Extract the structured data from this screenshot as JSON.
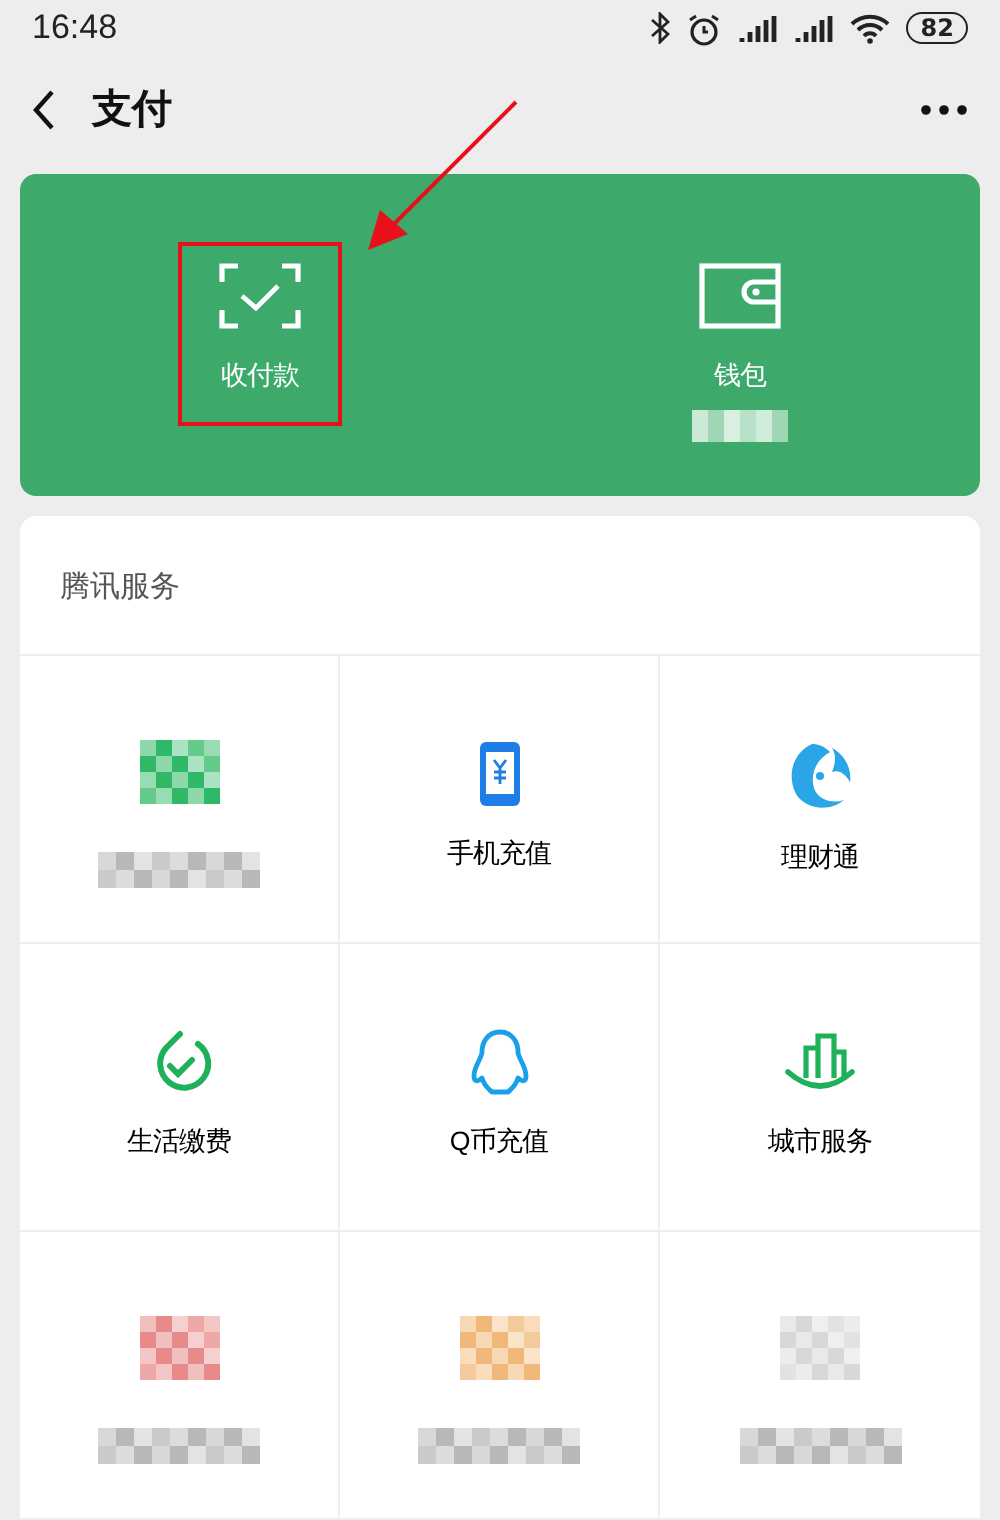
{
  "status_bar": {
    "time": "16:48",
    "battery": "82"
  },
  "header": {
    "title": "支付"
  },
  "actions": [
    {
      "kind": "scan",
      "label": "收付款",
      "highlighted": true,
      "masked_caption": false
    },
    {
      "kind": "wallet",
      "label": "钱包",
      "highlighted": false,
      "masked_caption": true
    }
  ],
  "services": {
    "title": "腾讯服务",
    "items": [
      {
        "kind": "masked",
        "color": "#2fb866"
      },
      {
        "kind": "phone",
        "label": "手机充值"
      },
      {
        "kind": "fund",
        "label": "理财通"
      },
      {
        "kind": "bill",
        "label": "生活缴费"
      },
      {
        "kind": "qq",
        "label": "Q币充值"
      },
      {
        "kind": "city",
        "label": "城市服务"
      },
      {
        "kind": "masked",
        "color": "#e88a8a"
      },
      {
        "kind": "masked",
        "color": "#f0b878"
      },
      {
        "kind": "masked",
        "color": "#d8d8d8"
      }
    ]
  }
}
